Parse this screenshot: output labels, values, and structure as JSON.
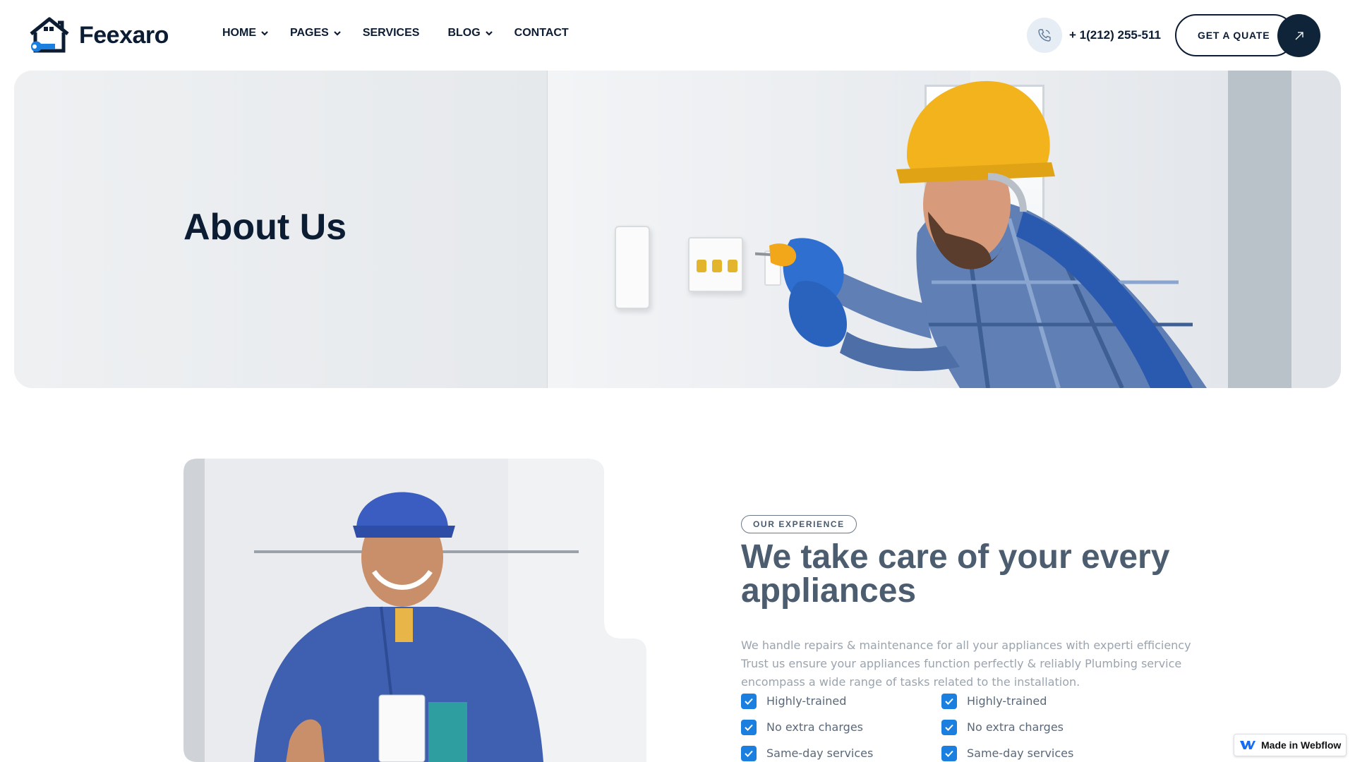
{
  "brand": {
    "name": "Feexaro"
  },
  "nav": {
    "items": [
      {
        "label": "HOME",
        "dropdown": true
      },
      {
        "label": "PAGES",
        "dropdown": true
      },
      {
        "label": "SERVICES",
        "dropdown": false
      },
      {
        "label": "BLOG",
        "dropdown": true
      },
      {
        "label": "CONTACT",
        "dropdown": false
      }
    ]
  },
  "header": {
    "phone": "+ 1(212) 255-511",
    "quote_label": "GET A QUATE"
  },
  "hero": {
    "title": "About Us"
  },
  "about": {
    "badge": "OUR EXPERIENCE",
    "headline": "We take care of your every appliances",
    "description": "We handle repairs & maintenance for all your appliances with experti efficiency Trust us ensure your appliances function perfectly & reliably Plumbing service encompass a wide range of tasks related to the installation.",
    "checks": [
      [
        "Highly-trained",
        "Highly-trained"
      ],
      [
        "No extra charges",
        "No extra charges"
      ],
      [
        "Same-day services",
        "Same-day services"
      ]
    ]
  },
  "webflow_badge": "Made in Webflow",
  "colors": {
    "navy": "#0b1c33",
    "accent_blue": "#1b7fe0",
    "phone_circle_bg": "#e6edf4"
  },
  "icons": [
    "house-wrench-logo-icon",
    "chevron-down-icon",
    "phone-icon",
    "arrow-up-right-icon",
    "checkbox-checked-icon",
    "webflow-logo-icon"
  ]
}
